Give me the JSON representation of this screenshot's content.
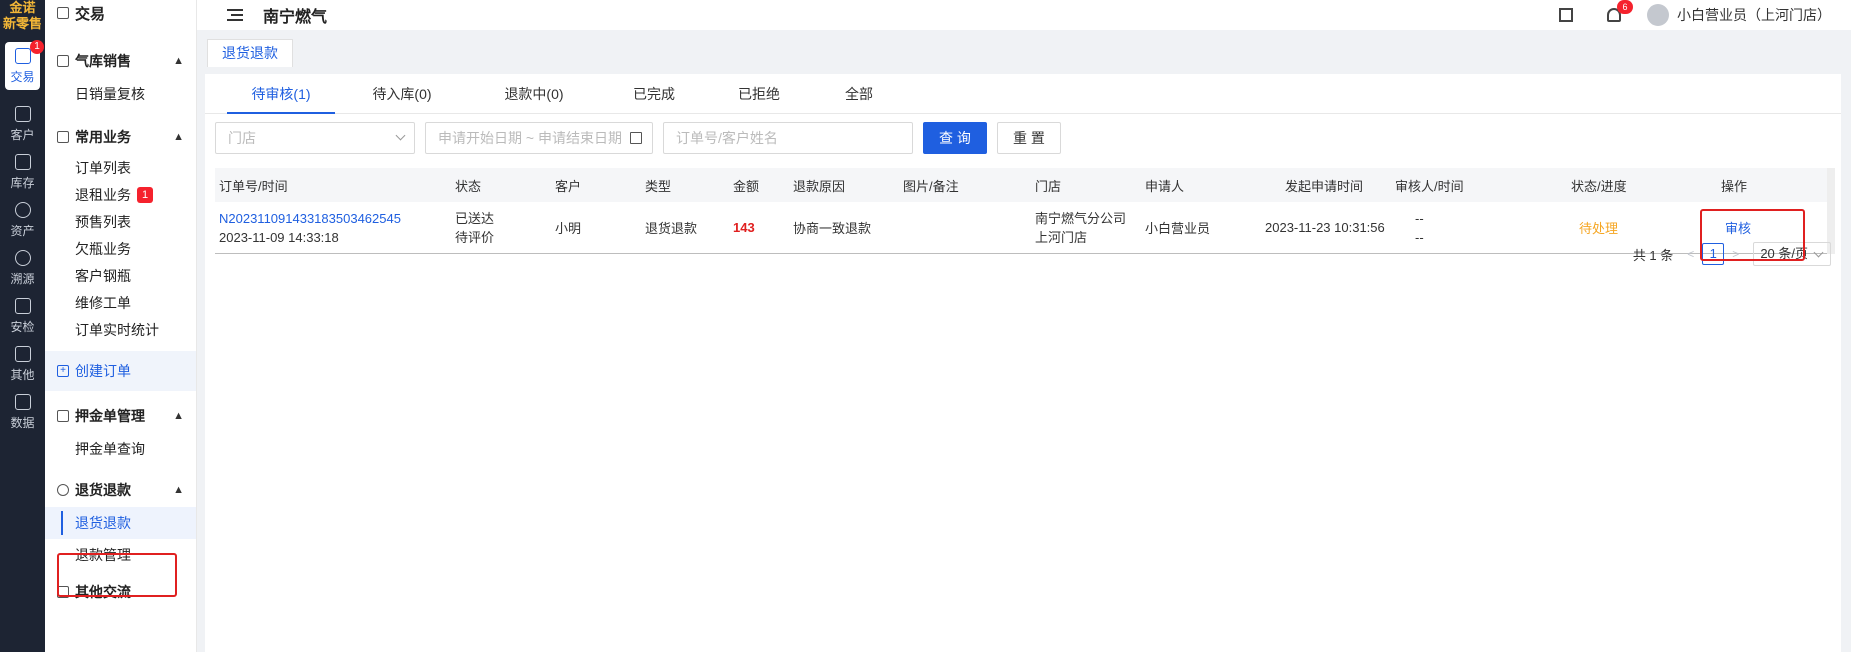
{
  "rail": {
    "logo_line1": "金诺",
    "logo_line2": "新零售",
    "items": [
      {
        "label": "交易",
        "badge": "1"
      },
      {
        "label": "客户"
      },
      {
        "label": "库存"
      },
      {
        "label": "资产"
      },
      {
        "label": "溯源"
      },
      {
        "label": "安检"
      },
      {
        "label": "其他"
      },
      {
        "label": "数据"
      }
    ]
  },
  "sidebar": {
    "top_title": "交易",
    "sections": [
      {
        "title": "气库销售",
        "items": [
          {
            "label": "日销量复核"
          }
        ]
      },
      {
        "title": "常用业务",
        "items": [
          {
            "label": "订单列表"
          },
          {
            "label": "退租业务",
            "badge": "1"
          },
          {
            "label": "预售列表"
          },
          {
            "label": "欠瓶业务"
          },
          {
            "label": "客户钢瓶"
          },
          {
            "label": "维修工单"
          },
          {
            "label": "订单实时统计"
          }
        ]
      },
      {
        "title": "押金单管理",
        "items": [
          {
            "label": "押金单查询"
          }
        ]
      },
      {
        "title": "退货退款",
        "items": [
          {
            "label": "退货退款"
          },
          {
            "label": "退款管理"
          }
        ]
      },
      {
        "title": "其他交流"
      }
    ],
    "create_order": "创建订单"
  },
  "header": {
    "title": "南宁燃气",
    "bell_badge": "6",
    "user": "小白营业员（上河门店）"
  },
  "page_tab": "退货退款",
  "tabs": [
    "待审核(1)",
    "待入库(0)",
    "退款中(0)",
    "已完成",
    "已拒绝",
    "全部"
  ],
  "filters": {
    "store_placeholder": "门店",
    "date_placeholder": "申请开始日期 ~ 申请结束日期",
    "search_placeholder": "订单号/客户姓名",
    "query_label": "查 询",
    "reset_label": "重 置"
  },
  "table": {
    "headers": [
      "订单号/时间",
      "状态",
      "客户",
      "类型",
      "金额",
      "退款原因",
      "图片/备注",
      "门店",
      "申请人",
      "发起申请时间",
      "审核人/时间",
      "状态/进度",
      "操作"
    ],
    "rows": [
      {
        "order_no": "N20231109143318350346254 5",
        "order_no_full": "N202311091433183503462545",
        "order_time": "2023-11-09 14:33:18",
        "status_line1": "已送达",
        "status_line2": "待评价",
        "customer": "小明",
        "type": "退货退款",
        "amount": "143",
        "reason": "协商一致退款",
        "remark": "",
        "store_line1": "南宁燃气分公司",
        "store_line2": "上河门店",
        "applicant": "小白营业员",
        "apply_time": "2023-11-23 10:31:56",
        "reviewer_line1": "--",
        "reviewer_line2": "--",
        "progress": "待处理",
        "action": "审核"
      }
    ]
  },
  "pager": {
    "total": "共 1 条",
    "current": "1",
    "size": "20 条/页"
  }
}
